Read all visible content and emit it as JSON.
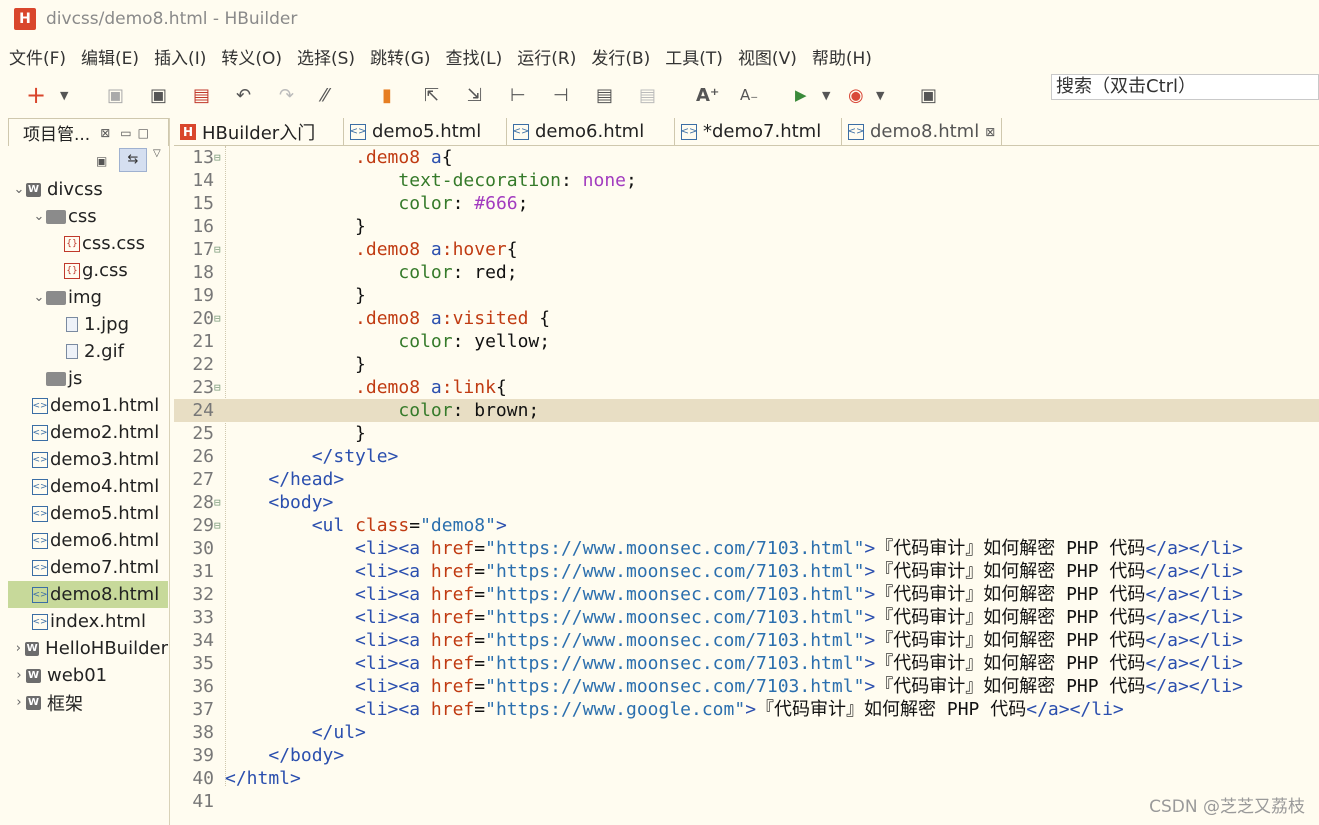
{
  "window": {
    "title": "divcss/demo8.html  -  HBuilder",
    "logo_letter": "H"
  },
  "menu": [
    "文件(F)",
    "编辑(E)",
    "插入(I)",
    "转义(O)",
    "选择(S)",
    "跳转(G)",
    "查找(L)",
    "运行(R)",
    "发行(B)",
    "工具(T)",
    "视图(V)",
    "帮助(H)"
  ],
  "search": {
    "placeholder": "搜索（双击Ctrl）"
  },
  "sidebar": {
    "tab_label": "项目管...",
    "tree": [
      {
        "label": "divcss",
        "level": 0,
        "type": "project",
        "expanded": true
      },
      {
        "label": "css",
        "level": 1,
        "type": "folder",
        "expanded": true
      },
      {
        "label": "css.css",
        "level": 2,
        "type": "css"
      },
      {
        "label": "g.css",
        "level": 2,
        "type": "css"
      },
      {
        "label": "img",
        "level": 1,
        "type": "folder",
        "expanded": true
      },
      {
        "label": "1.jpg",
        "level": 2,
        "type": "file"
      },
      {
        "label": "2.gif",
        "level": 2,
        "type": "file"
      },
      {
        "label": "js",
        "level": 1,
        "type": "folder"
      },
      {
        "label": "demo1.html",
        "level": 1,
        "type": "html"
      },
      {
        "label": "demo2.html",
        "level": 1,
        "type": "html"
      },
      {
        "label": "demo3.html",
        "level": 1,
        "type": "html"
      },
      {
        "label": "demo4.html",
        "level": 1,
        "type": "html"
      },
      {
        "label": "demo5.html",
        "level": 1,
        "type": "html"
      },
      {
        "label": "demo6.html",
        "level": 1,
        "type": "html"
      },
      {
        "label": "demo7.html",
        "level": 1,
        "type": "html"
      },
      {
        "label": "demo8.html",
        "level": 1,
        "type": "html",
        "selected": true
      },
      {
        "label": "index.html",
        "level": 1,
        "type": "html"
      },
      {
        "label": "HelloHBuilder",
        "level": 0,
        "type": "project",
        "expanded": false
      },
      {
        "label": "web01",
        "level": 0,
        "type": "project",
        "expanded": false
      },
      {
        "label": "框架",
        "level": 0,
        "type": "project",
        "expanded": false
      }
    ]
  },
  "tabs": [
    {
      "label": "HBuilder入门",
      "type": "hbuilder"
    },
    {
      "label": "demo5.html",
      "type": "html"
    },
    {
      "label": "demo6.html",
      "type": "html"
    },
    {
      "label": "*demo7.html",
      "type": "html"
    },
    {
      "label": "demo8.html",
      "type": "html",
      "active": true,
      "close": "⊠"
    }
  ],
  "editor": {
    "highlighted_line": 24,
    "lines": [
      {
        "n": "13",
        "fold": true,
        "indent": "            ",
        "parts": [
          [
            "sel",
            ".demo8 "
          ],
          [
            "tag",
            "a"
          ],
          [
            "plain",
            "{"
          ]
        ]
      },
      {
        "n": "14",
        "indent": "                ",
        "parts": [
          [
            "prop",
            "text-decoration"
          ],
          [
            "plain",
            ": "
          ],
          [
            "val",
            "none"
          ],
          [
            "plain",
            ";"
          ]
        ]
      },
      {
        "n": "15",
        "indent": "                ",
        "parts": [
          [
            "prop",
            "color"
          ],
          [
            "plain",
            ": "
          ],
          [
            "val",
            "#666"
          ],
          [
            "plain",
            ";"
          ]
        ]
      },
      {
        "n": "16",
        "indent": "            ",
        "parts": [
          [
            "plain",
            "}"
          ]
        ]
      },
      {
        "n": "17",
        "fold": true,
        "indent": "            ",
        "parts": [
          [
            "sel",
            ".demo8 "
          ],
          [
            "tag",
            "a"
          ],
          [
            "sel",
            ":hover"
          ],
          [
            "plain",
            "{"
          ]
        ]
      },
      {
        "n": "18",
        "indent": "                ",
        "parts": [
          [
            "prop",
            "color"
          ],
          [
            "plain",
            ": red;"
          ]
        ]
      },
      {
        "n": "19",
        "indent": "            ",
        "parts": [
          [
            "plain",
            "}"
          ]
        ]
      },
      {
        "n": "20",
        "fold": true,
        "indent": "            ",
        "parts": [
          [
            "sel",
            ".demo8 "
          ],
          [
            "tag",
            "a"
          ],
          [
            "sel",
            ":visited "
          ],
          [
            "plain",
            "{"
          ]
        ]
      },
      {
        "n": "21",
        "indent": "                ",
        "parts": [
          [
            "prop",
            "color"
          ],
          [
            "plain",
            ": yellow;"
          ]
        ]
      },
      {
        "n": "22",
        "indent": "            ",
        "parts": [
          [
            "plain",
            "}"
          ]
        ]
      },
      {
        "n": "23",
        "fold": true,
        "indent": "            ",
        "parts": [
          [
            "sel",
            ".demo8 "
          ],
          [
            "tag",
            "a"
          ],
          [
            "sel",
            ":link"
          ],
          [
            "plain",
            "{"
          ]
        ]
      },
      {
        "n": "24",
        "indent": "                ",
        "parts": [
          [
            "prop",
            "color"
          ],
          [
            "plain",
            ": brown;"
          ]
        ]
      },
      {
        "n": "25",
        "indent": "            ",
        "parts": [
          [
            "plain",
            "}"
          ]
        ]
      },
      {
        "n": "26",
        "indent": "        ",
        "parts": [
          [
            "tag",
            "</style>"
          ]
        ]
      },
      {
        "n": "27",
        "indent": "    ",
        "parts": [
          [
            "tag",
            "</head>"
          ]
        ]
      },
      {
        "n": "28",
        "fold": true,
        "indent": "    ",
        "parts": [
          [
            "tag",
            "<body>"
          ]
        ]
      },
      {
        "n": "29",
        "fold": true,
        "indent": "        ",
        "parts": [
          [
            "tag",
            "<ul "
          ],
          [
            "attr",
            "class"
          ],
          [
            "plain",
            "="
          ],
          [
            "str",
            "\"demo8\""
          ],
          [
            "tag",
            ">"
          ]
        ]
      },
      {
        "n": "30",
        "indent": "            ",
        "parts": [
          [
            "tag",
            "<li><a "
          ],
          [
            "attr",
            "href"
          ],
          [
            "plain",
            "="
          ],
          [
            "str",
            "\"https://www.moonsec.com/7103.html\""
          ],
          [
            "tag",
            ">"
          ],
          [
            "plain",
            "『代码审计』如何解密 PHP 代码"
          ],
          [
            "tag",
            "</a></li>"
          ]
        ]
      },
      {
        "n": "31",
        "indent": "            ",
        "parts": [
          [
            "tag",
            "<li><a "
          ],
          [
            "attr",
            "href"
          ],
          [
            "plain",
            "="
          ],
          [
            "str",
            "\"https://www.moonsec.com/7103.html\""
          ],
          [
            "tag",
            ">"
          ],
          [
            "plain",
            "『代码审计』如何解密 PHP 代码"
          ],
          [
            "tag",
            "</a></li>"
          ]
        ]
      },
      {
        "n": "32",
        "indent": "            ",
        "parts": [
          [
            "tag",
            "<li><a "
          ],
          [
            "attr",
            "href"
          ],
          [
            "plain",
            "="
          ],
          [
            "str",
            "\"https://www.moonsec.com/7103.html\""
          ],
          [
            "tag",
            ">"
          ],
          [
            "plain",
            "『代码审计』如何解密 PHP 代码"
          ],
          [
            "tag",
            "</a></li>"
          ]
        ]
      },
      {
        "n": "33",
        "indent": "            ",
        "parts": [
          [
            "tag",
            "<li><a "
          ],
          [
            "attr",
            "href"
          ],
          [
            "plain",
            "="
          ],
          [
            "str",
            "\"https://www.moonsec.com/7103.html\""
          ],
          [
            "tag",
            ">"
          ],
          [
            "plain",
            "『代码审计』如何解密 PHP 代码"
          ],
          [
            "tag",
            "</a></li>"
          ]
        ]
      },
      {
        "n": "34",
        "indent": "            ",
        "parts": [
          [
            "tag",
            "<li><a "
          ],
          [
            "attr",
            "href"
          ],
          [
            "plain",
            "="
          ],
          [
            "str",
            "\"https://www.moonsec.com/7103.html\""
          ],
          [
            "tag",
            ">"
          ],
          [
            "plain",
            "『代码审计』如何解密 PHP 代码"
          ],
          [
            "tag",
            "</a></li>"
          ]
        ]
      },
      {
        "n": "35",
        "indent": "            ",
        "parts": [
          [
            "tag",
            "<li><a "
          ],
          [
            "attr",
            "href"
          ],
          [
            "plain",
            "="
          ],
          [
            "str",
            "\"https://www.moonsec.com/7103.html\""
          ],
          [
            "tag",
            ">"
          ],
          [
            "plain",
            "『代码审计』如何解密 PHP 代码"
          ],
          [
            "tag",
            "</a></li>"
          ]
        ]
      },
      {
        "n": "36",
        "indent": "            ",
        "parts": [
          [
            "tag",
            "<li><a "
          ],
          [
            "attr",
            "href"
          ],
          [
            "plain",
            "="
          ],
          [
            "str",
            "\"https://www.moonsec.com/7103.html\""
          ],
          [
            "tag",
            ">"
          ],
          [
            "plain",
            "『代码审计』如何解密 PHP 代码"
          ],
          [
            "tag",
            "</a></li>"
          ]
        ]
      },
      {
        "n": "37",
        "indent": "            ",
        "parts": [
          [
            "tag",
            "<li><a "
          ],
          [
            "attr",
            "href"
          ],
          [
            "plain",
            "="
          ],
          [
            "str",
            "\"https://www.google.com\""
          ],
          [
            "tag",
            ">"
          ],
          [
            "plain",
            "『代码审计』如何解密 PHP 代码"
          ],
          [
            "tag",
            "</a></li>"
          ]
        ]
      },
      {
        "n": "38",
        "indent": "        ",
        "parts": [
          [
            "tag",
            "</ul>"
          ]
        ]
      },
      {
        "n": "39",
        "indent": "    ",
        "parts": [
          [
            "tag",
            "</body>"
          ]
        ]
      },
      {
        "n": "40",
        "indent": "",
        "parts": [
          [
            "tag",
            "</html>"
          ]
        ]
      },
      {
        "n": "41",
        "indent": "",
        "parts": []
      }
    ]
  },
  "watermark": "CSDN @芝芝又荔枝"
}
